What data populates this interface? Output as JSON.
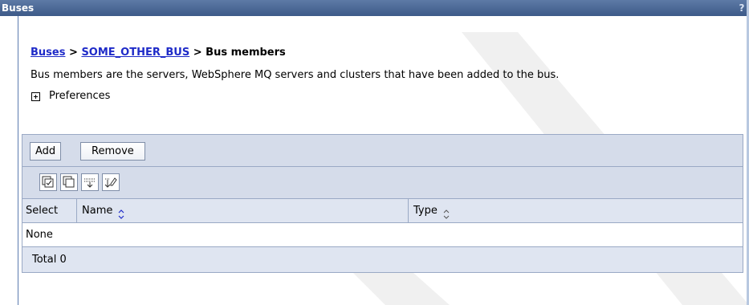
{
  "window": {
    "title": "Buses",
    "help_glyph": "?"
  },
  "breadcrumb": {
    "items": [
      {
        "label": "Buses",
        "link": true
      },
      {
        "label": "SOME_OTHER_BUS",
        "link": true
      },
      {
        "label": "Bus members",
        "link": false
      }
    ],
    "separator": ">"
  },
  "description": "Bus members are the servers, WebSphere MQ servers and clusters that have been added to the bus.",
  "preferences": {
    "label": "Preferences"
  },
  "toolbar": {
    "add_label": "Add",
    "remove_label": "Remove"
  },
  "icon_toolbar": {
    "icons": [
      "select-all-icon",
      "deselect-all-icon",
      "show-filter-icon",
      "clear-filter-icon"
    ]
  },
  "table": {
    "columns": [
      {
        "label": "Select"
      },
      {
        "label": "Name"
      },
      {
        "label": "Type"
      }
    ],
    "empty_text": "None",
    "total_text": "Total 0"
  },
  "colors": {
    "title_bar": "#4a6797",
    "panel_bg": "#d5dcea",
    "link": "#1f2bc8"
  }
}
